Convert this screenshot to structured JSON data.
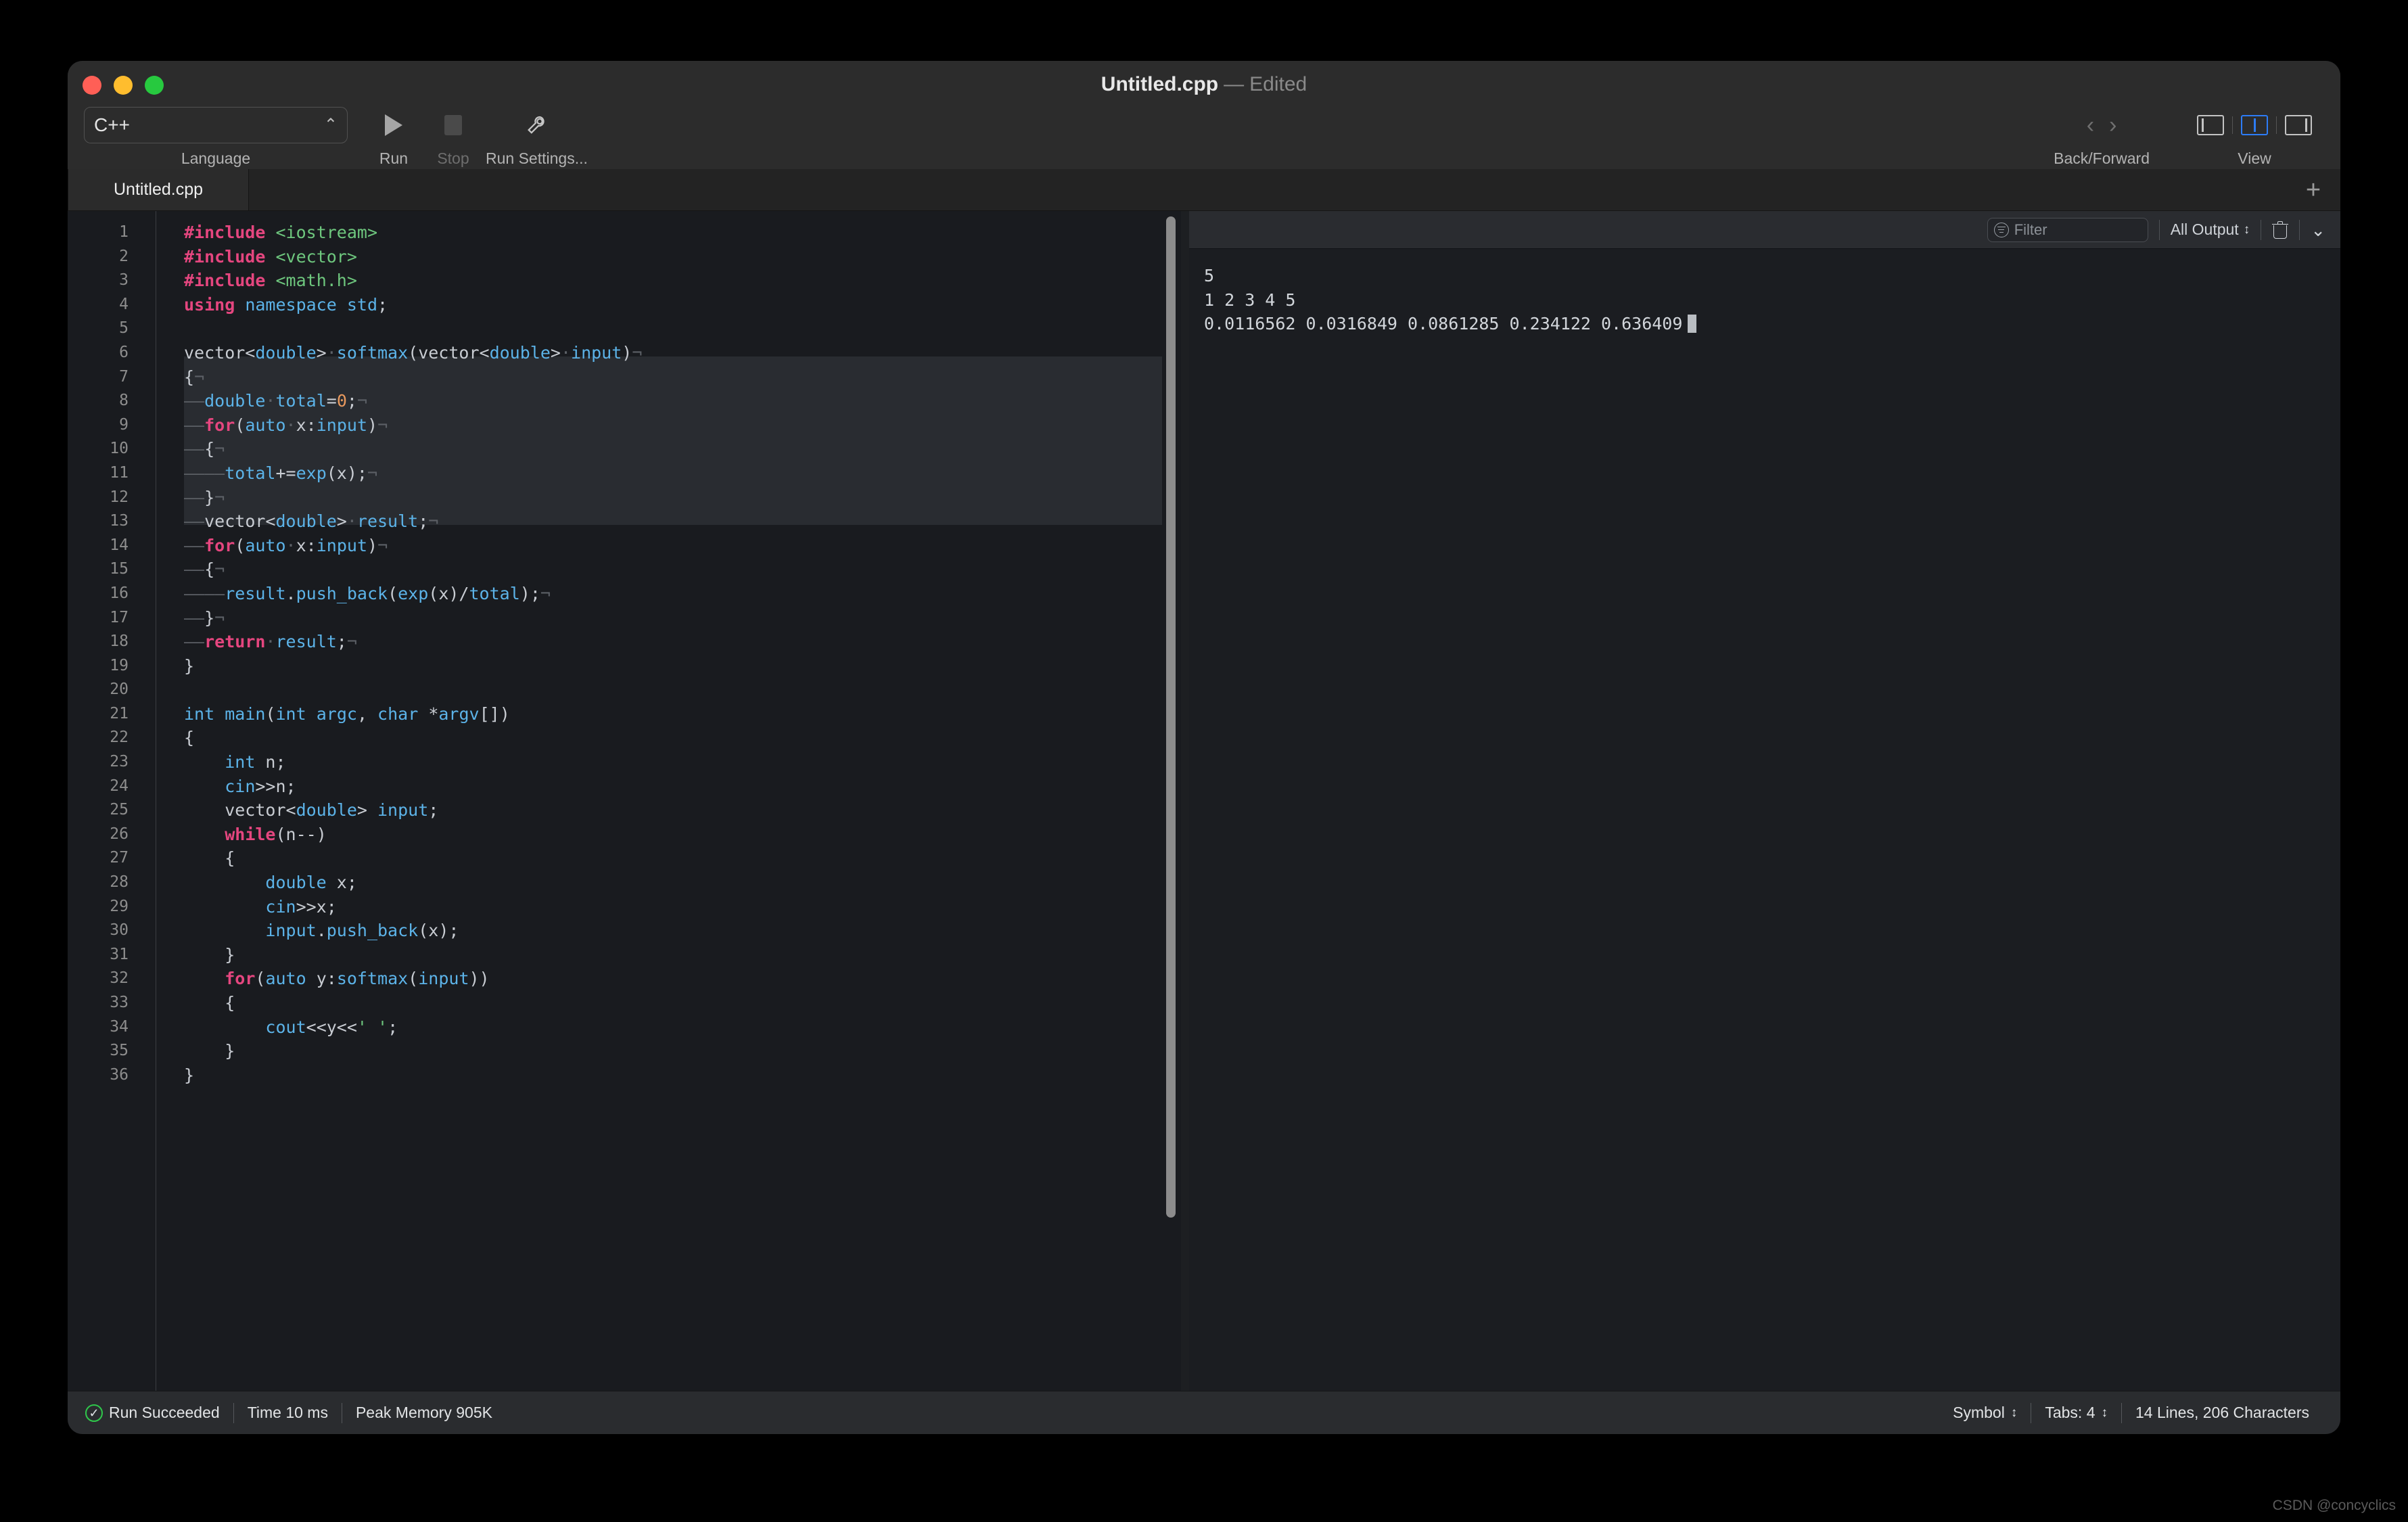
{
  "window": {
    "title_file": "Untitled.cpp",
    "title_dash": "—",
    "title_state": "Edited"
  },
  "toolbar": {
    "language_value": "C++",
    "language_caption": "Language",
    "run_caption": "Run",
    "stop_caption": "Stop",
    "run_settings_caption": "Run Settings...",
    "back_forward_caption": "Back/Forward",
    "view_caption": "View",
    "icons": {
      "run": "play-icon",
      "stop": "stop-icon",
      "settings": "wrench-icon",
      "back": "chevron-left-icon",
      "forward": "chevron-right-icon",
      "view_left": "panel-left-icon",
      "view_center": "panel-split-icon",
      "view_right": "panel-right-icon"
    }
  },
  "tabs": {
    "items": [
      {
        "label": "Untitled.cpp",
        "active": true
      }
    ],
    "add_label": "+"
  },
  "console": {
    "filter_placeholder": "Filter",
    "scope_label": "All Output",
    "clear_icon": "trash-icon",
    "collapse_icon": "chevron-down-icon",
    "output_lines": [
      "5",
      "1 2 3 4 5",
      "0.0116562 0.0316849 0.0861285 0.234122 0.636409"
    ]
  },
  "statusbar": {
    "run_status": "Run Succeeded",
    "time": "Time 10 ms",
    "memory": "Peak Memory 905K",
    "symbol": "Symbol",
    "tabs": "Tabs: 4",
    "counts": "14 Lines, 206 Characters"
  },
  "watermark": "CSDN @concyclics",
  "editor": {
    "total_lines": 36,
    "lines": [
      {
        "n": 1,
        "tokens": [
          {
            "t": "#include",
            "c": "k"
          },
          {
            "t": " ",
            "c": "w"
          },
          {
            "t": "<iostream>",
            "c": "s"
          }
        ]
      },
      {
        "n": 2,
        "tokens": [
          {
            "t": "#include",
            "c": "k"
          },
          {
            "t": " ",
            "c": "w"
          },
          {
            "t": "<vector>",
            "c": "s"
          }
        ]
      },
      {
        "n": 3,
        "tokens": [
          {
            "t": "#include",
            "c": "k"
          },
          {
            "t": " ",
            "c": "w"
          },
          {
            "t": "<math.h>",
            "c": "s"
          }
        ]
      },
      {
        "n": 4,
        "tokens": [
          {
            "t": "using",
            "c": "k"
          },
          {
            "t": " ",
            "c": "w"
          },
          {
            "t": "namespace",
            "c": "t"
          },
          {
            "t": " ",
            "c": "w"
          },
          {
            "t": "std",
            "c": "t"
          },
          {
            "t": ";",
            "c": "w"
          }
        ]
      },
      {
        "n": 5,
        "tokens": []
      },
      {
        "n": 6,
        "tokens": [
          {
            "t": "vector<",
            "c": "w"
          },
          {
            "t": "double",
            "c": "t"
          },
          {
            "t": ">",
            "c": "w"
          },
          {
            "t": "·",
            "c": "inv"
          },
          {
            "t": "softmax",
            "c": "t"
          },
          {
            "t": "(vector<",
            "c": "w"
          },
          {
            "t": "double",
            "c": "t"
          },
          {
            "t": ">",
            "c": "w"
          },
          {
            "t": "·",
            "c": "inv"
          },
          {
            "t": "input",
            "c": "t"
          },
          {
            "t": ")",
            "c": "w"
          },
          {
            "t": "¬",
            "c": "inv"
          }
        ]
      },
      {
        "n": 7,
        "tokens": [
          {
            "t": "{",
            "c": "w"
          },
          {
            "t": "¬",
            "c": "inv"
          }
        ]
      },
      {
        "n": 8,
        "tokens": [
          {
            "t": "——",
            "c": "inv"
          },
          {
            "t": "double",
            "c": "t"
          },
          {
            "t": "·",
            "c": "inv"
          },
          {
            "t": "total",
            "c": "t"
          },
          {
            "t": "=",
            "c": "w"
          },
          {
            "t": "0",
            "c": "n"
          },
          {
            "t": ";",
            "c": "w"
          },
          {
            "t": "¬",
            "c": "inv"
          }
        ]
      },
      {
        "n": 9,
        "tokens": [
          {
            "t": "——",
            "c": "inv"
          },
          {
            "t": "for",
            "c": "k"
          },
          {
            "t": "(",
            "c": "w"
          },
          {
            "t": "auto",
            "c": "t"
          },
          {
            "t": "·",
            "c": "inv"
          },
          {
            "t": "x",
            "c": "w"
          },
          {
            "t": ":",
            "c": "w"
          },
          {
            "t": "input",
            "c": "t"
          },
          {
            "t": ")",
            "c": "w"
          },
          {
            "t": "¬",
            "c": "inv"
          }
        ]
      },
      {
        "n": 10,
        "tokens": [
          {
            "t": "——",
            "c": "inv"
          },
          {
            "t": "{",
            "c": "w"
          },
          {
            "t": "¬",
            "c": "inv"
          }
        ]
      },
      {
        "n": 11,
        "tokens": [
          {
            "t": "————",
            "c": "inv"
          },
          {
            "t": "total",
            "c": "t"
          },
          {
            "t": "+=",
            "c": "w"
          },
          {
            "t": "exp",
            "c": "t"
          },
          {
            "t": "(x);",
            "c": "w"
          },
          {
            "t": "¬",
            "c": "inv"
          }
        ]
      },
      {
        "n": 12,
        "tokens": [
          {
            "t": "——",
            "c": "inv"
          },
          {
            "t": "}",
            "c": "w"
          },
          {
            "t": "¬",
            "c": "inv"
          }
        ]
      },
      {
        "n": 13,
        "tokens": [
          {
            "t": "——",
            "c": "inv"
          },
          {
            "t": "vector<",
            "c": "w"
          },
          {
            "t": "double",
            "c": "t"
          },
          {
            "t": ">",
            "c": "w"
          },
          {
            "t": "·",
            "c": "inv"
          },
          {
            "t": "result",
            "c": "t"
          },
          {
            "t": ";",
            "c": "w"
          },
          {
            "t": "¬",
            "c": "inv"
          }
        ]
      },
      {
        "n": 14,
        "tokens": [
          {
            "t": "——",
            "c": "inv"
          },
          {
            "t": "for",
            "c": "k"
          },
          {
            "t": "(",
            "c": "w"
          },
          {
            "t": "auto",
            "c": "t"
          },
          {
            "t": "·",
            "c": "inv"
          },
          {
            "t": "x",
            "c": "w"
          },
          {
            "t": ":",
            "c": "w"
          },
          {
            "t": "input",
            "c": "t"
          },
          {
            "t": ")",
            "c": "w"
          },
          {
            "t": "¬",
            "c": "inv"
          }
        ]
      },
      {
        "n": 15,
        "tokens": [
          {
            "t": "——",
            "c": "inv"
          },
          {
            "t": "{",
            "c": "w"
          },
          {
            "t": "¬",
            "c": "inv"
          }
        ]
      },
      {
        "n": 16,
        "tokens": [
          {
            "t": "————",
            "c": "inv"
          },
          {
            "t": "result",
            "c": "t"
          },
          {
            "t": ".",
            "c": "w"
          },
          {
            "t": "push_back",
            "c": "t"
          },
          {
            "t": "(",
            "c": "w"
          },
          {
            "t": "exp",
            "c": "t"
          },
          {
            "t": "(x)/",
            "c": "w"
          },
          {
            "t": "total",
            "c": "t"
          },
          {
            "t": ");",
            "c": "w"
          },
          {
            "t": "¬",
            "c": "inv"
          }
        ]
      },
      {
        "n": 17,
        "tokens": [
          {
            "t": "——",
            "c": "inv"
          },
          {
            "t": "}",
            "c": "w"
          },
          {
            "t": "¬",
            "c": "inv"
          }
        ]
      },
      {
        "n": 18,
        "tokens": [
          {
            "t": "——",
            "c": "inv"
          },
          {
            "t": "return",
            "c": "k"
          },
          {
            "t": "·",
            "c": "inv"
          },
          {
            "t": "result",
            "c": "t"
          },
          {
            "t": ";",
            "c": "w"
          },
          {
            "t": "¬",
            "c": "inv"
          }
        ]
      },
      {
        "n": 19,
        "tokens": [
          {
            "t": "}",
            "c": "w"
          }
        ]
      },
      {
        "n": 20,
        "tokens": []
      },
      {
        "n": 21,
        "tokens": [
          {
            "t": "int",
            "c": "t"
          },
          {
            "t": " ",
            "c": "w"
          },
          {
            "t": "main",
            "c": "t"
          },
          {
            "t": "(",
            "c": "w"
          },
          {
            "t": "int",
            "c": "t"
          },
          {
            "t": " ",
            "c": "w"
          },
          {
            "t": "argc",
            "c": "t"
          },
          {
            "t": ", ",
            "c": "w"
          },
          {
            "t": "char",
            "c": "t"
          },
          {
            "t": " *",
            "c": "w"
          },
          {
            "t": "argv",
            "c": "t"
          },
          {
            "t": "[])",
            "c": "w"
          }
        ]
      },
      {
        "n": 22,
        "tokens": [
          {
            "t": "{",
            "c": "w"
          }
        ]
      },
      {
        "n": 23,
        "tokens": [
          {
            "t": "    ",
            "c": "w"
          },
          {
            "t": "int",
            "c": "t"
          },
          {
            "t": " n;",
            "c": "w"
          }
        ]
      },
      {
        "n": 24,
        "tokens": [
          {
            "t": "    ",
            "c": "w"
          },
          {
            "t": "cin",
            "c": "t"
          },
          {
            "t": ">>n;",
            "c": "w"
          }
        ]
      },
      {
        "n": 25,
        "tokens": [
          {
            "t": "    vector<",
            "c": "w"
          },
          {
            "t": "double",
            "c": "t"
          },
          {
            "t": "> ",
            "c": "w"
          },
          {
            "t": "input",
            "c": "t"
          },
          {
            "t": ";",
            "c": "w"
          }
        ]
      },
      {
        "n": 26,
        "tokens": [
          {
            "t": "    ",
            "c": "w"
          },
          {
            "t": "while",
            "c": "k"
          },
          {
            "t": "(n--)",
            "c": "w"
          }
        ]
      },
      {
        "n": 27,
        "tokens": [
          {
            "t": "    {",
            "c": "w"
          }
        ]
      },
      {
        "n": 28,
        "tokens": [
          {
            "t": "        ",
            "c": "w"
          },
          {
            "t": "double",
            "c": "t"
          },
          {
            "t": " x;",
            "c": "w"
          }
        ]
      },
      {
        "n": 29,
        "tokens": [
          {
            "t": "        ",
            "c": "w"
          },
          {
            "t": "cin",
            "c": "t"
          },
          {
            "t": ">>x;",
            "c": "w"
          }
        ]
      },
      {
        "n": 30,
        "tokens": [
          {
            "t": "        ",
            "c": "w"
          },
          {
            "t": "input",
            "c": "t"
          },
          {
            "t": ".",
            "c": "w"
          },
          {
            "t": "push_back",
            "c": "t"
          },
          {
            "t": "(x);",
            "c": "w"
          }
        ]
      },
      {
        "n": 31,
        "tokens": [
          {
            "t": "    }",
            "c": "w"
          }
        ]
      },
      {
        "n": 32,
        "tokens": [
          {
            "t": "    ",
            "c": "w"
          },
          {
            "t": "for",
            "c": "k"
          },
          {
            "t": "(",
            "c": "w"
          },
          {
            "t": "auto",
            "c": "t"
          },
          {
            "t": " y:",
            "c": "w"
          },
          {
            "t": "softmax",
            "c": "t"
          },
          {
            "t": "(",
            "c": "w"
          },
          {
            "t": "input",
            "c": "t"
          },
          {
            "t": "))",
            "c": "w"
          }
        ]
      },
      {
        "n": 33,
        "tokens": [
          {
            "t": "    {",
            "c": "w"
          }
        ]
      },
      {
        "n": 34,
        "tokens": [
          {
            "t": "        ",
            "c": "w"
          },
          {
            "t": "cout",
            "c": "t"
          },
          {
            "t": "<<y<<",
            "c": "w"
          },
          {
            "t": "' '",
            "c": "s"
          },
          {
            "t": ";",
            "c": "w"
          }
        ]
      },
      {
        "n": 35,
        "tokens": [
          {
            "t": "    }",
            "c": "w"
          }
        ]
      },
      {
        "n": 36,
        "tokens": [
          {
            "t": "}",
            "c": "w"
          }
        ]
      }
    ]
  }
}
